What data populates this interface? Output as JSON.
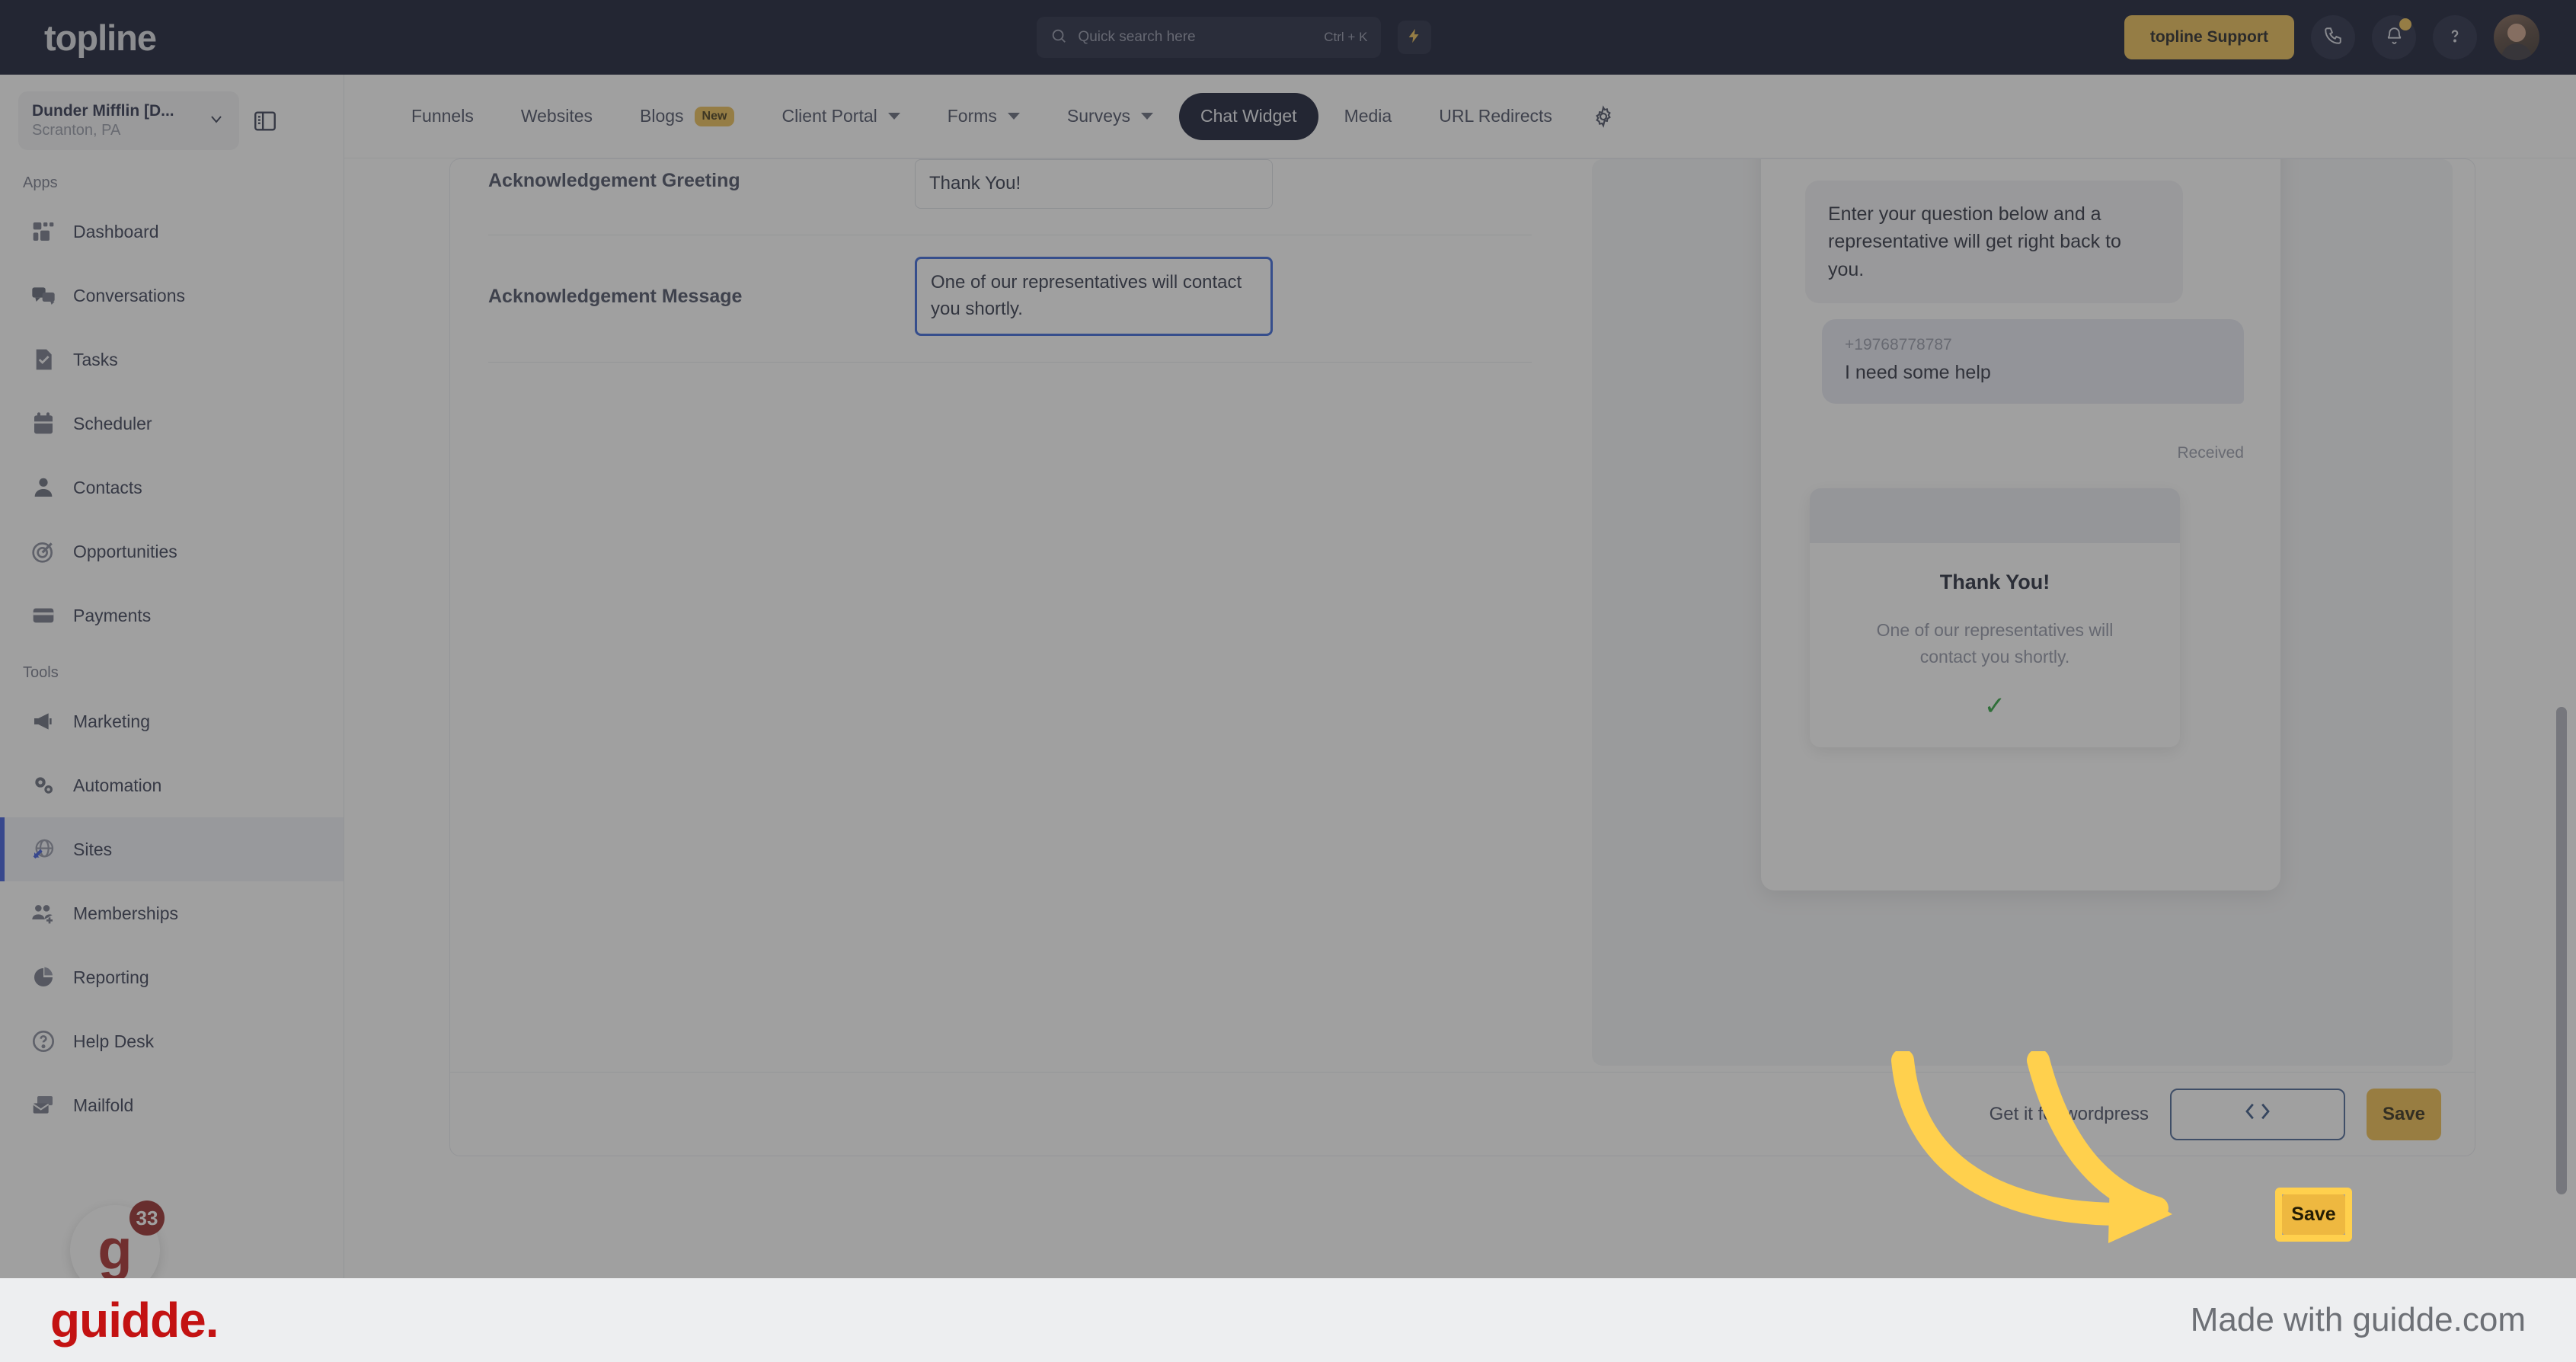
{
  "topbar": {
    "logo": "topline",
    "search": {
      "placeholder": "Quick search here",
      "shortcut": "Ctrl + K",
      "icon": "search-icon"
    },
    "bolt_icon": "lightning-bolt-icon",
    "support_button": "topline Support",
    "phone_icon": "phone-icon",
    "bell_icon": "bell-icon",
    "help_icon": "question-mark-icon",
    "avatar": "user-avatar"
  },
  "sidebar": {
    "org_name": "Dunder Mifflin [D...",
    "org_location": "Scranton, PA",
    "panel_toggle_icon": "panel-collapse-icon",
    "sections": [
      {
        "title": "Apps",
        "items": [
          {
            "label": "Dashboard",
            "icon": "dashboard-icon",
            "active": false
          },
          {
            "label": "Conversations",
            "icon": "chat-bubbles-icon",
            "active": false
          },
          {
            "label": "Tasks",
            "icon": "task-check-icon",
            "active": false
          },
          {
            "label": "Scheduler",
            "icon": "calendar-icon",
            "active": false
          },
          {
            "label": "Contacts",
            "icon": "person-icon",
            "active": false
          },
          {
            "label": "Opportunities",
            "icon": "target-icon",
            "active": false
          },
          {
            "label": "Payments",
            "icon": "credit-card-icon",
            "active": false
          }
        ]
      },
      {
        "title": "Tools",
        "items": [
          {
            "label": "Marketing",
            "icon": "megaphone-icon",
            "active": false
          },
          {
            "label": "Automation",
            "icon": "gears-icon",
            "active": false
          },
          {
            "label": "Sites",
            "icon": "globe-arrow-icon",
            "active": true
          },
          {
            "label": "Memberships",
            "icon": "people-add-icon",
            "active": false
          },
          {
            "label": "Reporting",
            "icon": "pie-chart-icon",
            "active": false
          },
          {
            "label": "Help Desk",
            "icon": "help-circle-icon",
            "active": false
          },
          {
            "label": "Mailfold",
            "icon": "mail-stack-icon",
            "active": false
          }
        ]
      }
    ],
    "guidde_fab": {
      "letter": "g",
      "badge": "33"
    }
  },
  "tabs": [
    {
      "label": "Funnels",
      "active": false,
      "dropdown": false,
      "badge": null
    },
    {
      "label": "Websites",
      "active": false,
      "dropdown": false,
      "badge": null
    },
    {
      "label": "Blogs",
      "active": false,
      "dropdown": false,
      "badge": "New"
    },
    {
      "label": "Client Portal",
      "active": false,
      "dropdown": true,
      "badge": null
    },
    {
      "label": "Forms",
      "active": false,
      "dropdown": true,
      "badge": null
    },
    {
      "label": "Surveys",
      "active": false,
      "dropdown": true,
      "badge": null
    },
    {
      "label": "Chat Widget",
      "active": true,
      "dropdown": false,
      "badge": null
    },
    {
      "label": "Media",
      "active": false,
      "dropdown": false,
      "badge": null
    },
    {
      "label": "URL Redirects",
      "active": false,
      "dropdown": false,
      "badge": null
    }
  ],
  "tab_settings_icon": "gear-icon",
  "form": {
    "rows": [
      {
        "label": "Acknowledgement Greeting",
        "value": "Thank You!",
        "focused": false
      },
      {
        "label": "Acknowledgement Message",
        "value": "One of our representatives will contact you shortly.",
        "focused": true
      }
    ]
  },
  "preview": {
    "bot_message": "Enter your question below and a representative will get right back to you.",
    "user_phone": "+19768778787",
    "user_message": "I need some help",
    "status": "Received",
    "ack_card": {
      "title": "Thank You!",
      "message": "One of our representatives will contact you shortly.",
      "check_icon": "green-check-icon"
    }
  },
  "footer": {
    "wordpress_link": "Get it for wordpress",
    "code_button_icon": "code-brackets-icon",
    "save_button": "Save"
  },
  "annotation": {
    "arrow_icon": "curved-arrow-icon",
    "highlight_color": "#ffd04d"
  },
  "guidde_bar": {
    "logo": "guidde.",
    "tagline": "Made with guidde.com"
  },
  "colors": {
    "brand_dark": "#050a24",
    "accent_gold": "#e9b949",
    "active_blue": "#2f4fd8",
    "focus_blue": "#2a5bd7",
    "guidde_red": "#c31212",
    "highlight_yellow": "#ffd04d"
  }
}
